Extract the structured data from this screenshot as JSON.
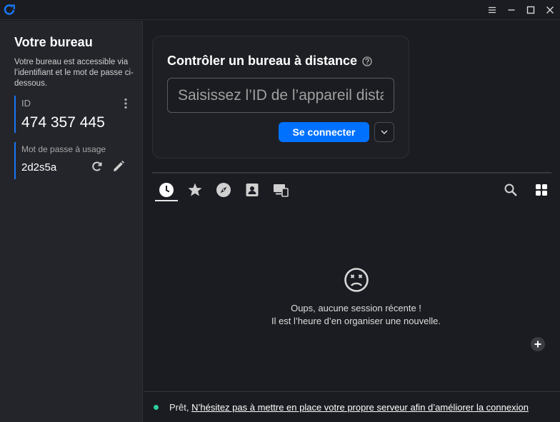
{
  "app": {
    "logo_icon": "rustdesk-logo-icon",
    "accent": "#1877f2"
  },
  "window_controls": [
    "menu-icon",
    "minimize-icon",
    "maximize-icon",
    "close-icon"
  ],
  "sidebar": {
    "title": "Votre bureau",
    "description": "Votre bureau est accessible via l’identifiant et le mot de passe ci-dessous.",
    "id_label": "ID",
    "id_value": "474 357 445",
    "password_label": "Mot de passe à usage",
    "password_value": "2d2s5a"
  },
  "connect_card": {
    "title": "Contrôler un bureau à distance",
    "input_placeholder": "Saisissez l’ID de l’appareil distant",
    "input_value": "",
    "connect_label": "Se connecter",
    "button_color": "#0071ff"
  },
  "tabs": [
    {
      "name": "recent",
      "icon": "clock-icon",
      "active": true
    },
    {
      "name": "favorites",
      "icon": "star-icon",
      "active": false
    },
    {
      "name": "discovered",
      "icon": "compass-icon",
      "active": false
    },
    {
      "name": "address-book",
      "icon": "contact-icon",
      "active": false
    },
    {
      "name": "devices",
      "icon": "devices-icon",
      "active": false
    }
  ],
  "tools": [
    "search-icon",
    "grid-view-icon"
  ],
  "empty_state": {
    "icon": "sad-face-icon",
    "line1": "Oups, aucune session récente !",
    "line2": "Il est l’heure d’en organiser une nouvelle."
  },
  "status_bar": {
    "status_color": "#2ecc9a",
    "status": "Prêt,",
    "link": "N’hésitez pas à mettre en place votre propre serveur afin d’améliorer la connexion"
  }
}
